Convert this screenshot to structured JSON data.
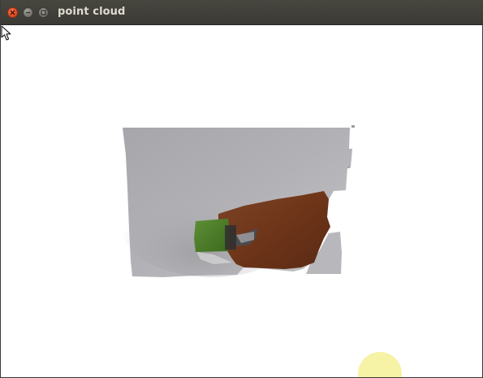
{
  "window": {
    "title": "point cloud",
    "controls": {
      "close": "close-icon",
      "minimize": "minimize-icon",
      "maximize": "maximize-icon"
    }
  },
  "viewport": {
    "background_color": "#ffffff",
    "content": "point-cloud-render",
    "colors": {
      "wall": "#a9a8ad",
      "hand": "#7a3e22",
      "object": "#4a7a2a",
      "cursor_highlight": "#f5f096"
    }
  }
}
